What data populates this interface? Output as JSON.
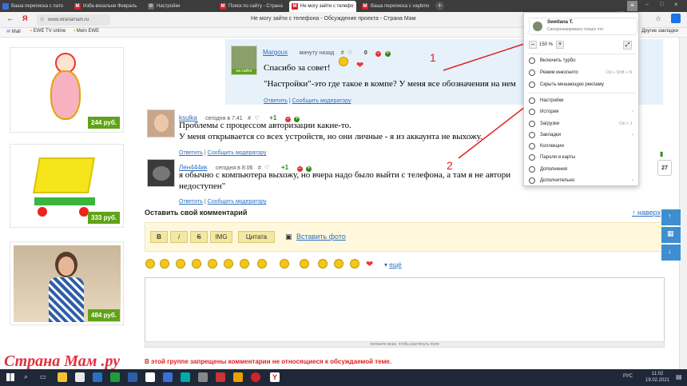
{
  "tabs": [
    {
      "label": "Ваша переписка с пато",
      "active": false
    },
    {
      "label": "Изба-вязальня Февраль",
      "active": false
    },
    {
      "label": "Настройки",
      "active": false
    },
    {
      "label": "Поиск по сайту - Страна",
      "active": false
    },
    {
      "label": "Не могу зайти с телефо",
      "active": true
    },
    {
      "label": "Ваша переписка с vaybmo",
      "active": false
    }
  ],
  "address": {
    "url": "www.stranamam.ru",
    "page_title": "Не могу зайти с телефона - Обсуждение проекта - Страна Мам"
  },
  "bookmarks": [
    "Mail",
    "EWE TV online",
    "Mein EWE"
  ],
  "bookmarks_right": "Другие закладки",
  "products": [
    {
      "price": "244 руб."
    },
    {
      "price": "333 руб."
    },
    {
      "price": "484 руб."
    }
  ],
  "comments": [
    {
      "name": "Margoux",
      "time": "минуту назад",
      "score": "0",
      "badge": "на сайте",
      "lines": [
        "Спасибо за совет!",
        "\"Настройки\"-это где такое в компе? У меня все обозначения на нем"
      ],
      "reply": "Ответить",
      "report": "Сообщить модератору"
    },
    {
      "name": "ksulka",
      "time": "сегодня в 7:41",
      "score": "+1",
      "lines": [
        "Проблемы с процессом авторизации какие-то.",
        "У меня открывается со всех устройств, но они личные - я из аккаунта не выхожу."
      ],
      "reply": "Ответить",
      "report": "Сообщить модератору"
    },
    {
      "name": "Лен444ик",
      "time": "сегодня в 8:06",
      "score": "+1",
      "lines": [
        "я обычно с компьютера выхожу, но вчера надо было выйти с телефона, а там я не автори",
        "недоступен\""
      ],
      "reply": "Ответить",
      "report": "Сообщить модератору"
    }
  ],
  "comment_form": {
    "heading": "Оставить свой комментарий",
    "up_link": "↑ наверх",
    "buttons": [
      "B",
      "i",
      "S",
      "IMG",
      "Цитата"
    ],
    "insert_photo": "Вставить фото",
    "more_smiles": "ещё",
    "resize_hint": "потяните вниз, чтобы растянуть поле",
    "warning": "В этой группе запрещены комментарии не относящиеся к обсуждаемой теме."
  },
  "annotations": {
    "one": "1",
    "two": "2"
  },
  "menu": {
    "user": "Swetlana T.",
    "sync": "Синхронизировано только что",
    "zoom": "150 %",
    "items": [
      {
        "label": "Включить турбо",
        "icon": "turbo-icon",
        "arrow": false,
        "shortcut": ""
      },
      {
        "label": "Режим инкогнито",
        "icon": "incognito-icon",
        "arrow": false,
        "shortcut": "Ctrl + Shift + N"
      },
      {
        "label": "Скрыть мешающую рекламу",
        "icon": "block-icon",
        "arrow": false,
        "shortcut": ""
      },
      {
        "label": "Настройки",
        "icon": "gear-icon",
        "arrow": false,
        "shortcut": ""
      },
      {
        "label": "История",
        "icon": "clock-icon",
        "arrow": true,
        "shortcut": ""
      },
      {
        "label": "Загрузки",
        "icon": "download-icon",
        "arrow": false,
        "shortcut": "Ctrl + J"
      },
      {
        "label": "Закладки",
        "icon": "star-icon",
        "arrow": true,
        "shortcut": ""
      },
      {
        "label": "Коллекции",
        "icon": "collection-icon",
        "arrow": false,
        "shortcut": ""
      },
      {
        "label": "Пароли и карты",
        "icon": "key-icon",
        "arrow": false,
        "shortcut": ""
      },
      {
        "label": "Дополнения",
        "icon": "puzzle-icon",
        "arrow": false,
        "shortcut": ""
      },
      {
        "label": "Дополнительно",
        "icon": "more-icon",
        "arrow": true,
        "shortcut": ""
      }
    ]
  },
  "side": {
    "count": "27"
  },
  "footer": {
    "logo": "Страна Мам .ру"
  },
  "taskbar": {
    "lang": "РУС",
    "time": "11:02",
    "date": "19.02.2021"
  }
}
